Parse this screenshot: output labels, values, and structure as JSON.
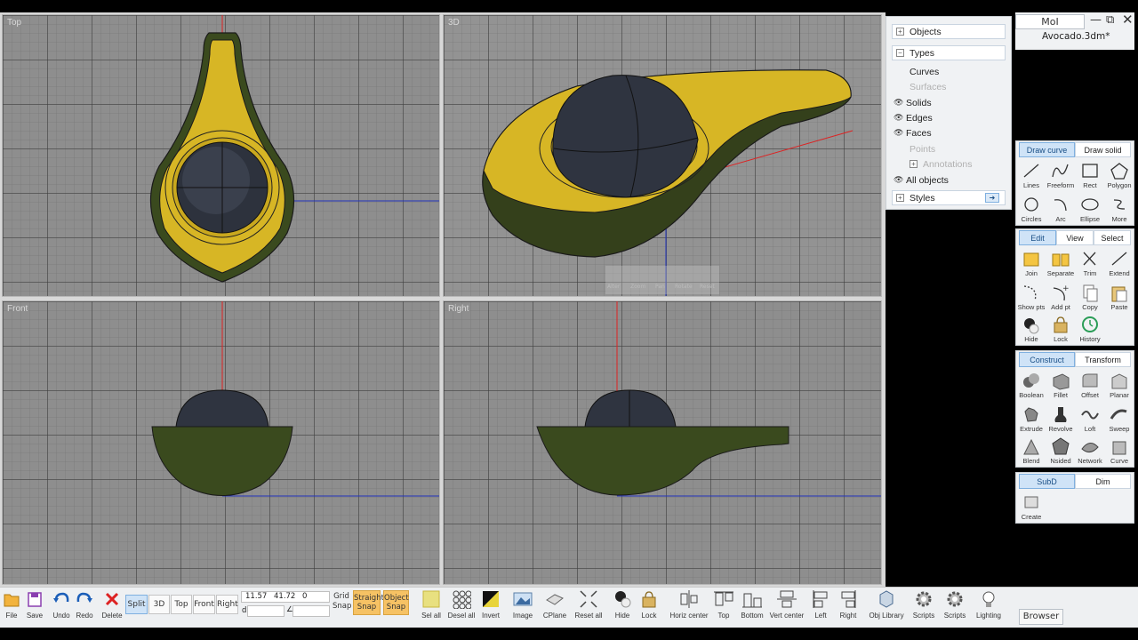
{
  "window": {
    "app_button": "MoI",
    "filename": "Avocado.3dm*"
  },
  "viewports": [
    {
      "title": "Top"
    },
    {
      "title": "3D"
    },
    {
      "title": "Front"
    },
    {
      "title": "Right"
    }
  ],
  "object_panel": {
    "rows": [
      {
        "label": "Objects",
        "expander": "+"
      },
      {
        "label": "Types",
        "expander": "−"
      },
      {
        "label": "Curves"
      },
      {
        "label": "Surfaces"
      },
      {
        "label": "Solids"
      },
      {
        "label": "Edges"
      },
      {
        "label": "Faces"
      },
      {
        "label": "Points"
      },
      {
        "label": "Annotations",
        "expander": "+"
      },
      {
        "label": "All objects"
      },
      {
        "label": "Styles",
        "expander": "+"
      }
    ]
  },
  "draw_panel": {
    "tabs": [
      "Draw curve",
      "Draw solid"
    ],
    "tools": [
      "Lines",
      "Freeform",
      "Rect",
      "Polygon",
      "Circles",
      "Arc",
      "Ellipse",
      "More"
    ]
  },
  "edit_panel": {
    "tabs": [
      "Edit",
      "View",
      "Select"
    ],
    "tools": [
      "Join",
      "Separate",
      "Trim",
      "Extend",
      "Show pts",
      "Add pt",
      "Copy",
      "Paste",
      "Hide",
      "Lock",
      "History"
    ]
  },
  "construct_panel": {
    "tabs": [
      "Construct",
      "Transform"
    ],
    "tools": [
      "Boolean",
      "Fillet",
      "Offset",
      "Planar",
      "Extrude",
      "Revolve",
      "Loft",
      "Sweep",
      "Blend",
      "Nsided",
      "Network",
      "Curve"
    ]
  },
  "subd_panel": {
    "tabs": [
      "SubD",
      "Dim"
    ],
    "tools": [
      "Create"
    ]
  },
  "view_controls": [
    "Alter",
    "Zoom",
    "Pan",
    "Rotate",
    "Reset"
  ],
  "bottom_toolbar": {
    "file": "File",
    "save": "Save",
    "undo": "Undo",
    "redo": "Redo",
    "delete": "Delete",
    "views": [
      "Split",
      "3D",
      "Top",
      "Front",
      "Right"
    ],
    "coords": {
      "x": "11.57",
      "y": "41.72",
      "z": "0",
      "d_label": "d",
      "angle_label": "∠"
    },
    "grid_snap": [
      "Grid",
      "Snap"
    ],
    "straight_snap": [
      "Straight",
      "Snap"
    ],
    "object_snap": [
      "Object",
      "Snap"
    ],
    "tools": [
      "Sel all",
      "Desel all",
      "Invert",
      "Image",
      "CPlane",
      "Reset all",
      "Hide",
      "Lock",
      "Horiz center",
      "Top",
      "Bottom",
      "Vert center",
      "Left",
      "Right",
      "Obj Library",
      "Scripts",
      "Scripts",
      "Lighting"
    ],
    "browser": "Browser"
  }
}
